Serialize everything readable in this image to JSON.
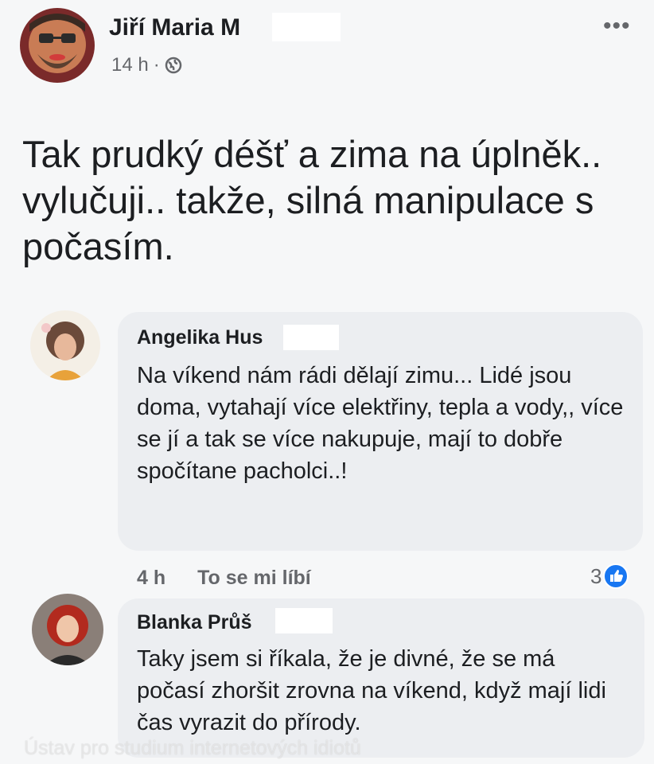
{
  "post": {
    "author_name": "Jiří Maria M",
    "time": "14 h",
    "separator": "·",
    "privacy_icon": "globe-icon",
    "more_icon": "more-options-icon",
    "text": "Tak prudký déšť a zima na úplněk.. vylučuji.. takže, silná manipulace s počasím."
  },
  "comments": [
    {
      "author_name": "Angelika Hus",
      "text": "Na víkend nám rádi dělají zimu... Lidé jsou doma, vytahají více elektřiny, tepla a vody,, více se jí a tak se více nakupuje, mají to dobře spočítane pacholci..!",
      "time": "4 h",
      "like_action": "To se mi líbí",
      "reaction_count": "3",
      "reaction_icon": "like-icon"
    },
    {
      "author_name": "Blanka Průš",
      "text": "Taky jsem si říkala, že je divné, že se má počasí zhoršit zrovna na víkend, když mají lidi čas vyrazit do přírody."
    }
  ],
  "watermark": "Ústav pro studium internetových idiotů",
  "colors": {
    "background": "#f6f7f8",
    "bubble": "#eceef1",
    "secondary_text": "#65676b",
    "like_blue": "#1877f2"
  }
}
